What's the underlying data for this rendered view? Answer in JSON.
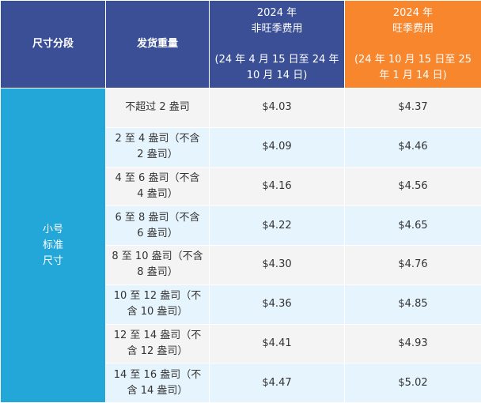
{
  "headers": {
    "size_tier": "尺寸分段",
    "weight": "发货重量",
    "off_peak": {
      "year": "2024 年",
      "label": "非旺季费用",
      "range": "(24 年 4 月 15 日至 24 年 10 月 14 日)"
    },
    "peak": {
      "year": "2024 年",
      "label": "旺季费用",
      "range": "(24 年 10 月 15 日至 25 年 1 月 14 日)"
    }
  },
  "tier_label": [
    "小号",
    "标准",
    "尺寸"
  ],
  "rows": [
    {
      "weight": "不超过 2 盎司",
      "off_peak": "$4.03",
      "peak": "$4.37"
    },
    {
      "weight": "2 至 4 盎司（不含 2 盎司）",
      "off_peak": "$4.09",
      "peak": "$4.46"
    },
    {
      "weight": "4 至 6 盎司（不含 4 盎司）",
      "off_peak": "$4.16",
      "peak": "$4.56"
    },
    {
      "weight": "6 至 8 盎司（不含 6 盎司）",
      "off_peak": "$4.22",
      "peak": "$4.65"
    },
    {
      "weight": "8 至 10 盎司（不含 8 盎司）",
      "off_peak": "$4.30",
      "peak": "$4.76"
    },
    {
      "weight": "10 至 12 盎司（不含 10 盎司）",
      "off_peak": "$4.36",
      "peak": "$4.85"
    },
    {
      "weight": "12 至 14 盎司（不含 12 盎司）",
      "off_peak": "$4.41",
      "peak": "$4.93"
    },
    {
      "weight": "14 至 16 盎司（不含 14 盎司）",
      "off_peak": "$4.47",
      "peak": "$5.02"
    }
  ],
  "colors": {
    "header_blue": "#3a4f96",
    "header_orange": "#f7862d",
    "tier_cyan": "#23a7d9",
    "row_gray": "#f4f4f4",
    "row_blue": "#e6f4fd"
  }
}
